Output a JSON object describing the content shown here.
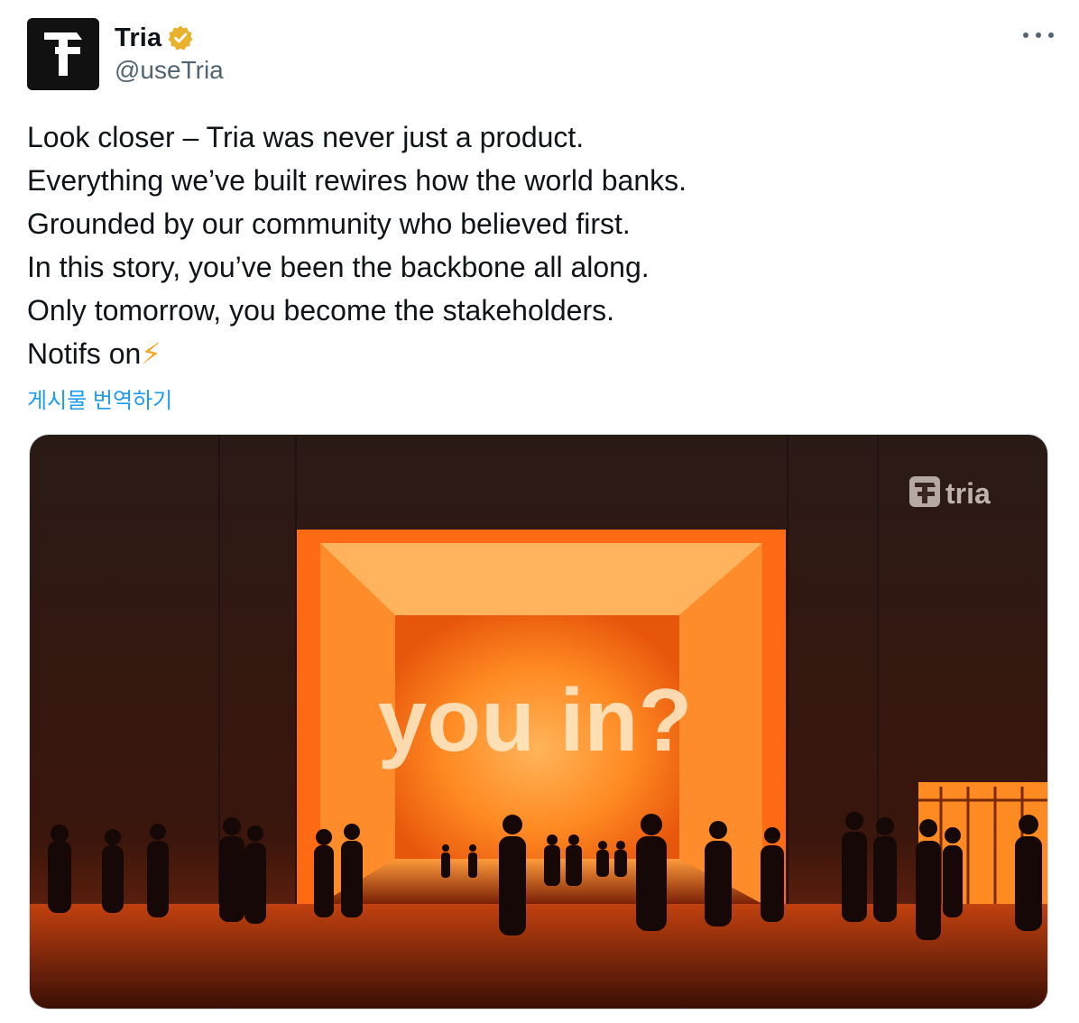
{
  "author": {
    "display_name": "Tria",
    "handle": "@useTria",
    "avatar_icon": "tria-logo-icon",
    "verified_icon": "verified-badge-icon",
    "verified_color": "#e8b22c"
  },
  "menu": {
    "more_icon": "more-options-icon"
  },
  "tweet": {
    "lines": [
      "Look closer – Tria was never just a product.",
      "Everything we’ve built rewires how the world banks.",
      "Grounded by our community who believed first.",
      "In this story, you’ve been the backbone all along.",
      "Only tomorrow, you become the stakeholders.",
      "Notifs on"
    ],
    "emoji": "⚡",
    "translate_label": "게시물 번역하기"
  },
  "media": {
    "headline": "you in?",
    "brand": "tria",
    "accent": "#ff7a1a"
  }
}
